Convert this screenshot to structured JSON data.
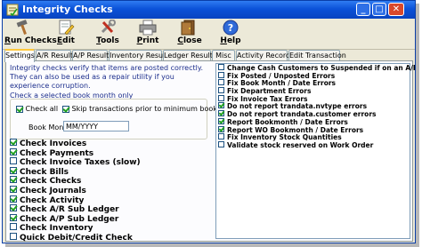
{
  "window": {
    "title": "Integrity Checks"
  },
  "titlebar_buttons": {
    "minimize": "_",
    "maximize": "□",
    "close": "✕"
  },
  "toolbar": [
    {
      "label": "Run Checks",
      "underline": "R",
      "rest": "un Checks",
      "icon": "hammer-run-icon"
    },
    {
      "label": "Edit",
      "underline": "E",
      "rest": "dit",
      "icon": "pencil-edit-icon"
    },
    {
      "label": "Tools",
      "underline": "T",
      "rest": "ools",
      "icon": "tools-icon"
    },
    {
      "label": "Print",
      "underline": "P",
      "rest": "rint",
      "icon": "printer-icon"
    },
    {
      "label": "Close",
      "underline": "C",
      "rest": "lose",
      "icon": "close-door-icon"
    },
    {
      "label": "Help",
      "underline": "H",
      "rest": "elp",
      "icon": "help-icon"
    }
  ],
  "tabs": [
    "Settings",
    "A/R Results",
    "A/P Results",
    "Inventory Results",
    "Ledger Results",
    "Misc",
    "Activity Records",
    "Edit Transaction"
  ],
  "active_tab": "Settings",
  "settings": {
    "info": "Integrity checks verify that items are posted correctly.  They can also be used as a repair utility if you experience corruption.",
    "group_title": "Check a selected book month only",
    "check_all_label": "Check all",
    "check_all": true,
    "skip_label": "Skip transactions prior to minimum book month",
    "skip": true,
    "book_month_label": "Book Month",
    "book_month_value": "MM/YYYY"
  },
  "checks": [
    {
      "label": "Check Invoices",
      "checked": true
    },
    {
      "label": "Check Payments",
      "checked": true
    },
    {
      "label": "Check Invoice Taxes (slow)",
      "checked": false
    },
    {
      "label": "Check Bills",
      "checked": true
    },
    {
      "label": "Check Checks",
      "checked": true
    },
    {
      "label": "Check Journals",
      "checked": true
    },
    {
      "label": "Check Activity",
      "checked": true
    },
    {
      "label": "Check A/R Sub Ledger",
      "checked": true
    },
    {
      "label": "Check A/P Sub Ledger",
      "checked": true
    },
    {
      "label": "Check Inventory",
      "checked": false
    },
    {
      "label": "Quick Debit/Credit Check",
      "checked": false
    }
  ],
  "repairs": [
    {
      "label": "Change Cash Customers to Suspended if on an A/R Invoice",
      "checked": false
    },
    {
      "label": "Fix Posted / Unposted Errors",
      "checked": false
    },
    {
      "label": "Fix Book Month / Date Errors",
      "checked": false
    },
    {
      "label": "Fix Department Errors",
      "checked": false
    },
    {
      "label": "Fix Invoice Tax Errors",
      "checked": false
    },
    {
      "label": "Do not report trandata.nvtype errors",
      "checked": true
    },
    {
      "label": "Do not report trandata.customer errors",
      "checked": true
    },
    {
      "label": "Report Bookmonth / Date Errors",
      "checked": true
    },
    {
      "label": "Report WO Bookmonth / Date Errors",
      "checked": true
    },
    {
      "label": "Fix Inventory Stock Quantities",
      "checked": false
    },
    {
      "label": "Validate stock reserved on Work Order",
      "checked": false
    }
  ]
}
